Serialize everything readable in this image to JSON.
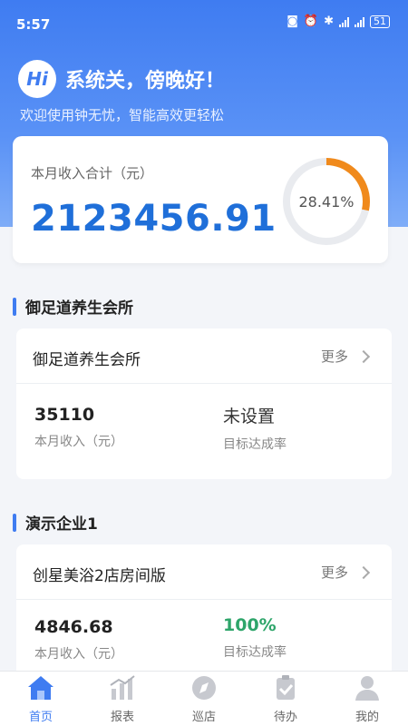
{
  "status": {
    "time": "5:57",
    "battery": "51"
  },
  "greeting": {
    "badge": "Hi",
    "title": "系统关，傍晚好！",
    "subtitle": "欢迎使用钟无忧，智能高效更轻松"
  },
  "summary": {
    "label": "本月收入合计（元）",
    "amount": "2123456.91",
    "percent_text": "28.41%",
    "percent_value": 0.2841
  },
  "sections": [
    {
      "title": "御足道养生会所",
      "card": {
        "name": "御足道养生会所",
        "more_label": "更多",
        "income_value": "35110",
        "income_label": "本月收入（元）",
        "target_value": "未设置",
        "target_label": "目标达成率"
      }
    },
    {
      "title": "演示企业1",
      "card": {
        "name": "创星美浴2店房间版",
        "more_label": "更多",
        "income_value": "4846.68",
        "income_label": "本月收入（元）",
        "target_value": "100%",
        "target_label": "目标达成率"
      }
    }
  ],
  "tabs": [
    {
      "label": "首页",
      "icon": "home-icon",
      "active": true
    },
    {
      "label": "报表",
      "icon": "report-icon"
    },
    {
      "label": "巡店",
      "icon": "compass-icon"
    },
    {
      "label": "待办",
      "icon": "clipboard-check-icon"
    },
    {
      "label": "我的",
      "icon": "user-icon"
    }
  ],
  "colors": {
    "primary": "#3f7cf1",
    "amount": "#1f6fd9",
    "ring": "#f08a1c",
    "success": "#2ea56a"
  }
}
